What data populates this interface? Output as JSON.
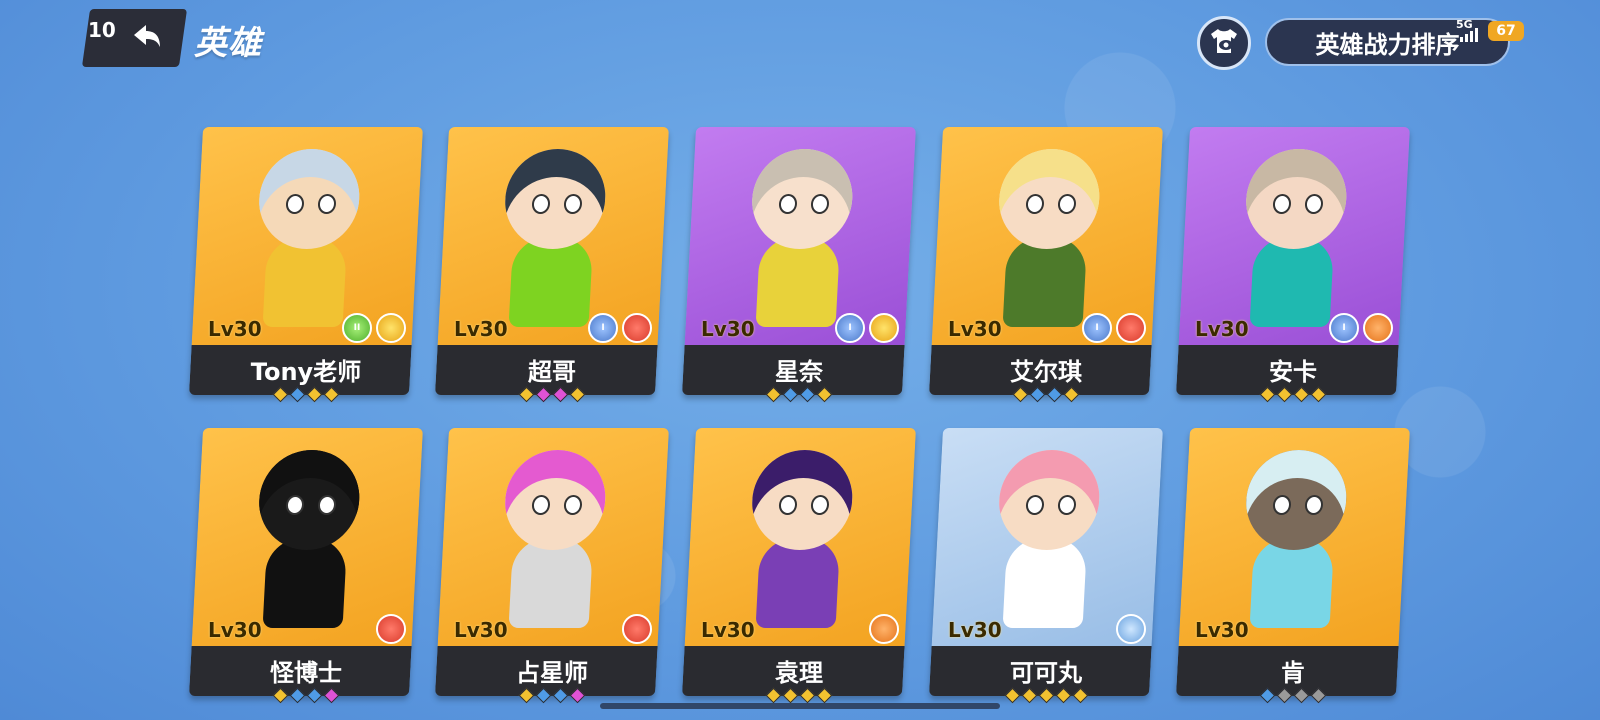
{
  "header": {
    "back_count": "10",
    "title": "英雄",
    "rank_button": "英雄战力排序"
  },
  "status_bar": {
    "network": "5G",
    "battery": "67"
  },
  "heroes": [
    {
      "name": "Tony老师",
      "level": "Lv30",
      "bg": "orange",
      "colors": [
        "#c7d7e6",
        "#f5d9b8",
        "#f1c232"
      ],
      "badges": [
        {
          "type": "green",
          "label": "II"
        },
        {
          "type": "gold",
          "label": ""
        }
      ],
      "dots": [
        "#f2c230",
        "#4f9be6",
        "#f2c230",
        "#f2c230"
      ]
    },
    {
      "name": "超哥",
      "level": "Lv30",
      "bg": "orange",
      "colors": [
        "#2f3b4a",
        "#f7dcc4",
        "#7ed321"
      ],
      "badges": [
        {
          "type": "blue",
          "label": "I"
        },
        {
          "type": "red",
          "label": ""
        }
      ],
      "dots": [
        "#f2c230",
        "#e052d6",
        "#e052d6",
        "#f2c230"
      ]
    },
    {
      "name": "星奈",
      "level": "Lv30",
      "bg": "purple",
      "colors": [
        "#c9bfb1",
        "#f7e0cc",
        "#e8d23a"
      ],
      "badges": [
        {
          "type": "blue",
          "label": "I"
        },
        {
          "type": "gold",
          "label": ""
        }
      ],
      "dots": [
        "#f2c230",
        "#4f9be6",
        "#4f9be6",
        "#f2c230"
      ]
    },
    {
      "name": "艾尔琪",
      "level": "Lv30",
      "bg": "orange",
      "colors": [
        "#f6e08a",
        "#f7dcc4",
        "#4d7a2a"
      ],
      "badges": [
        {
          "type": "blue",
          "label": "I"
        },
        {
          "type": "red",
          "label": ""
        }
      ],
      "dots": [
        "#f2c230",
        "#4f9be6",
        "#4f9be6",
        "#f2c230"
      ]
    },
    {
      "name": "安卡",
      "level": "Lv30",
      "bg": "purple",
      "colors": [
        "#c8b8a4",
        "#f4d8c4",
        "#1fb9b0"
      ],
      "badges": [
        {
          "type": "blue",
          "label": "I"
        },
        {
          "type": "orange",
          "label": ""
        }
      ],
      "dots": [
        "#f2c230",
        "#f2c230",
        "#f2c230",
        "#f2c230"
      ]
    },
    {
      "name": "怪博士",
      "level": "Lv30",
      "bg": "orange",
      "colors": [
        "#111111",
        "#1a1a1a",
        "#111111"
      ],
      "badges": [
        {
          "type": "red",
          "label": ""
        }
      ],
      "dots": [
        "#f2c230",
        "#4f9be6",
        "#4f9be6",
        "#e052d6"
      ]
    },
    {
      "name": "占星师",
      "level": "Lv30",
      "bg": "orange",
      "colors": [
        "#e45ad0",
        "#f7dcc4",
        "#d9d9d9"
      ],
      "badges": [
        {
          "type": "red",
          "label": ""
        }
      ],
      "dots": [
        "#f2c230",
        "#4f9be6",
        "#4f9be6",
        "#e052d6"
      ]
    },
    {
      "name": "袁理",
      "level": "Lv30",
      "bg": "orange",
      "colors": [
        "#3b1d6a",
        "#f7dcc4",
        "#7a3fb5"
      ],
      "badges": [
        {
          "type": "orange",
          "label": ""
        }
      ],
      "dots": [
        "#f2c230",
        "#f2c230",
        "#f2c230",
        "#f2c230"
      ]
    },
    {
      "name": "可可丸",
      "level": "Lv30",
      "bg": "blue",
      "colors": [
        "#f49bb0",
        "#f7dcc4",
        "#ffffff"
      ],
      "badges": [
        {
          "type": "sky",
          "label": ""
        }
      ],
      "dots": [
        "#f2c230",
        "#f2c230",
        "#f2c230",
        "#f2c230",
        "#f2c230"
      ]
    },
    {
      "name": "肯",
      "level": "Lv30",
      "bg": "orange",
      "colors": [
        "#d7eef2",
        "#7b6a5a",
        "#79d6e6"
      ],
      "badges": [],
      "dots": [
        "#4f9be6",
        "#9a9a9a",
        "#9a9a9a",
        "#9a9a9a"
      ]
    }
  ]
}
